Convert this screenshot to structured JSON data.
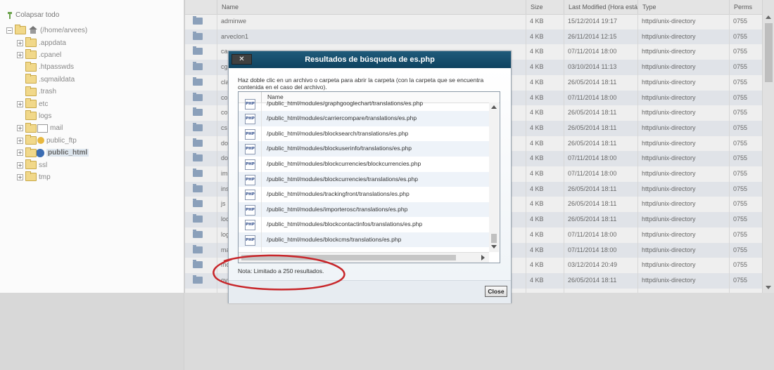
{
  "tree": {
    "collapse_all": "Colapsar todo",
    "root": "(/home/arvees)",
    "items": [
      {
        "label": ".appdata",
        "expandable": true
      },
      {
        "label": ".cpanel",
        "expandable": true
      },
      {
        "label": ".htpasswds",
        "expandable": false
      },
      {
        "label": ".sqmaildata",
        "expandable": false
      },
      {
        "label": ".trash",
        "expandable": false
      },
      {
        "label": "etc",
        "expandable": true
      },
      {
        "label": "logs",
        "expandable": false
      },
      {
        "label": "mail",
        "expandable": true
      },
      {
        "label": "public_ftp",
        "expandable": true
      },
      {
        "label": "public_html",
        "expandable": true,
        "selected": true
      },
      {
        "label": "ssl",
        "expandable": true
      },
      {
        "label": "tmp",
        "expandable": true
      }
    ]
  },
  "file_list": {
    "headers": {
      "name": "Name",
      "size": "Size",
      "modified": "Last Modified (Hora está",
      "type": "Type",
      "perms": "Perms"
    },
    "rows": [
      {
        "name": "adminwe",
        "size": "4 KB",
        "modified": "15/12/2014 19:17",
        "type": "httpd/unix-directory",
        "perms": "0755"
      },
      {
        "name": "arveclon1",
        "size": "4 KB",
        "modified": "26/11/2014 12:15",
        "type": "httpd/unix-directory",
        "perms": "0755"
      },
      {
        "name": "ca",
        "size": "4 KB",
        "modified": "07/11/2014 18:00",
        "type": "httpd/unix-directory",
        "perms": "0755"
      },
      {
        "name": "cg",
        "size": "4 KB",
        "modified": "03/10/2014 11:13",
        "type": "httpd/unix-directory",
        "perms": "0755"
      },
      {
        "name": "cla",
        "size": "4 KB",
        "modified": "26/05/2014 18:11",
        "type": "httpd/unix-directory",
        "perms": "0755"
      },
      {
        "name": "co",
        "size": "4 KB",
        "modified": "07/11/2014 18:00",
        "type": "httpd/unix-directory",
        "perms": "0755"
      },
      {
        "name": "co",
        "size": "4 KB",
        "modified": "26/05/2014 18:11",
        "type": "httpd/unix-directory",
        "perms": "0755"
      },
      {
        "name": "cs",
        "size": "4 KB",
        "modified": "26/05/2014 18:11",
        "type": "httpd/unix-directory",
        "perms": "0755"
      },
      {
        "name": "do",
        "size": "4 KB",
        "modified": "26/05/2014 18:11",
        "type": "httpd/unix-directory",
        "perms": "0755"
      },
      {
        "name": "do",
        "size": "4 KB",
        "modified": "07/11/2014 18:00",
        "type": "httpd/unix-directory",
        "perms": "0755"
      },
      {
        "name": "im",
        "size": "4 KB",
        "modified": "07/11/2014 18:00",
        "type": "httpd/unix-directory",
        "perms": "0755"
      },
      {
        "name": "ins",
        "size": "4 KB",
        "modified": "26/05/2014 18:11",
        "type": "httpd/unix-directory",
        "perms": "0755"
      },
      {
        "name": "js",
        "size": "4 KB",
        "modified": "26/05/2014 18:11",
        "type": "httpd/unix-directory",
        "perms": "0755"
      },
      {
        "name": "loc",
        "size": "4 KB",
        "modified": "26/05/2014 18:11",
        "type": "httpd/unix-directory",
        "perms": "0755"
      },
      {
        "name": "log",
        "size": "4 KB",
        "modified": "07/11/2014 18:00",
        "type": "httpd/unix-directory",
        "perms": "0755"
      },
      {
        "name": "ma",
        "size": "4 KB",
        "modified": "07/11/2014 18:00",
        "type": "httpd/unix-directory",
        "perms": "0755"
      },
      {
        "name": "mo",
        "size": "4 KB",
        "modified": "03/12/2014 20:49",
        "type": "httpd/unix-directory",
        "perms": "0755"
      },
      {
        "name": "ov",
        "size": "4 KB",
        "modified": "26/05/2014 18:11",
        "type": "httpd/unix-directory",
        "perms": "0755"
      }
    ]
  },
  "dialog": {
    "title": "Resultados de búsqueda de es.php",
    "close_x": "✕",
    "instructions": "Haz doble clic en un archivo o carpeta para abrir la carpeta (con la carpeta que se encuentra contenida en el caso del archivo).",
    "column_name": "Name",
    "file_icon_text": "PHP",
    "results": [
      "/public_html/modules/graphgooglechart/translations/es.php",
      "/public_html/modules/carriercompare/translations/es.php",
      "/public_html/modules/blocksearch/translations/es.php",
      "/public_html/modules/blockuserinfo/translations/es.php",
      "/public_html/modules/blockcurrencies/blockcurrencies.php",
      "/public_html/modules/blockcurrencies/translations/es.php",
      "/public_html/modules/trackingfront/translations/es.php",
      "/public_html/modules/importerosc/translations/es.php",
      "/public_html/modules/blockcontactinfos/translations/es.php",
      "/public_html/modules/blockcms/translations/es.php"
    ],
    "note": "Nota: Limitado a 250 resultados.",
    "close_button": "Close"
  },
  "colors": {
    "dialog_title_bg": "#0f4360",
    "annotation_red": "#c8262a",
    "row_alt": "#eef2f8"
  }
}
